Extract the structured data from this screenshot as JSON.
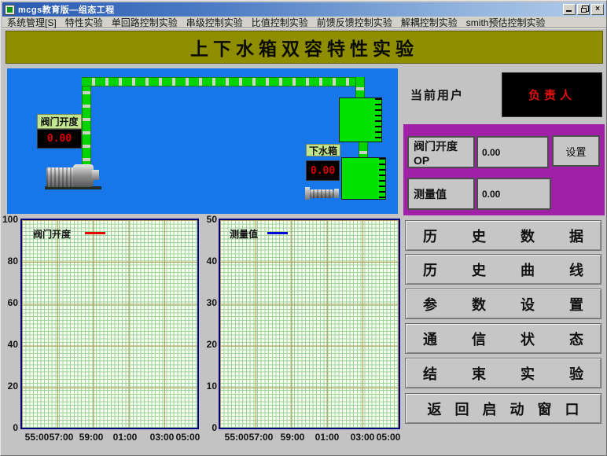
{
  "window": {
    "title": "mcgs教育版—组态工程",
    "controls": {
      "minimize": "",
      "restore": "",
      "close": "×"
    }
  },
  "menu": {
    "items": [
      "系统管理[S]",
      "特性实验",
      "单回路控制实验",
      "串级控制实验",
      "比值控制实验",
      "前馈反馈控制实验",
      "解耦控制实验",
      "smith预估控制实验"
    ]
  },
  "banner": {
    "title": "上下水箱双容特性实验"
  },
  "diagram": {
    "valve_label": "阀门开度",
    "valve_value": "0.00",
    "lower_tank_label": "下水箱",
    "lower_tank_value": "0.00"
  },
  "user_panel": {
    "label": "当前用户",
    "current_user": "负责人"
  },
  "control_panel": {
    "valve_op_label": "阀门开度OP",
    "valve_op_value": "0.00",
    "set_button": "设置",
    "measure_label": "测量值",
    "measure_value": "0.00"
  },
  "nav_buttons": [
    "历史数据",
    "历史曲线",
    "参数设置",
    "通信状态",
    "结束实验",
    "返回启动窗口"
  ],
  "colors": {
    "diagram_background": "#1877e8",
    "panel_purple": "#a020a8",
    "banner_olive": "#8e8e00",
    "pipe_green": "#00d400",
    "tank_green": "#00e200",
    "lcd_red": "#e00000",
    "chart_border_navy": "#000080",
    "valve_series": "#e80000",
    "measure_series": "#0000d8"
  },
  "chart_data": [
    {
      "type": "line",
      "title": "",
      "series": [
        {
          "name": "阀门开度",
          "color": "#e80000",
          "values": []
        }
      ],
      "x_ticks": [
        "55:00",
        "57:00",
        "59:00",
        "01:00",
        "03:00",
        "05:00"
      ],
      "y_ticks": [
        100,
        80,
        60,
        40,
        20,
        0
      ],
      "ylim": [
        0,
        100
      ],
      "grid": true,
      "legend_position": "top-left",
      "note": "empty trend - no data plotted yet"
    },
    {
      "type": "line",
      "title": "",
      "series": [
        {
          "name": "测量值",
          "color": "#0000d8",
          "values": []
        }
      ],
      "x_ticks": [
        "55:00",
        "57:00",
        "59:00",
        "01:00",
        "03:00",
        "05:00"
      ],
      "y_ticks": [
        50,
        40,
        30,
        20,
        10,
        0
      ],
      "ylim": [
        0,
        50
      ],
      "grid": true,
      "legend_position": "top-left",
      "note": "empty trend - no data plotted yet"
    }
  ]
}
